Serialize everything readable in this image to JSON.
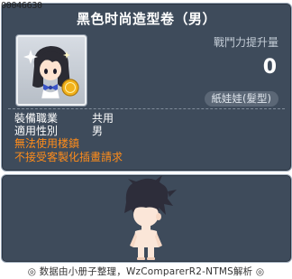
{
  "item_id": "00046630",
  "title": "黑色时尚造型卷（男）",
  "stat": {
    "label": "戰鬥力提升量",
    "value": "0"
  },
  "category_badge": "紙娃娃(髮型)",
  "attributes": [
    {
      "key": "裝備職業",
      "value": "共用"
    },
    {
      "key": "適用性別",
      "value": "男"
    }
  ],
  "warnings": [
    "無法使用楼鎮",
    "不接受客製化插畫請求"
  ],
  "footer": "◎ 数据由小册子整理，WzComparerR2-NTMS解析 ◎",
  "colors": {
    "panel_bg": "#3e4b5b",
    "warning": "#ff8c1a",
    "title": "#ffffff"
  },
  "icons": {
    "item_icon": "hairstyle-coupon-icon",
    "preview": "character-preview"
  }
}
